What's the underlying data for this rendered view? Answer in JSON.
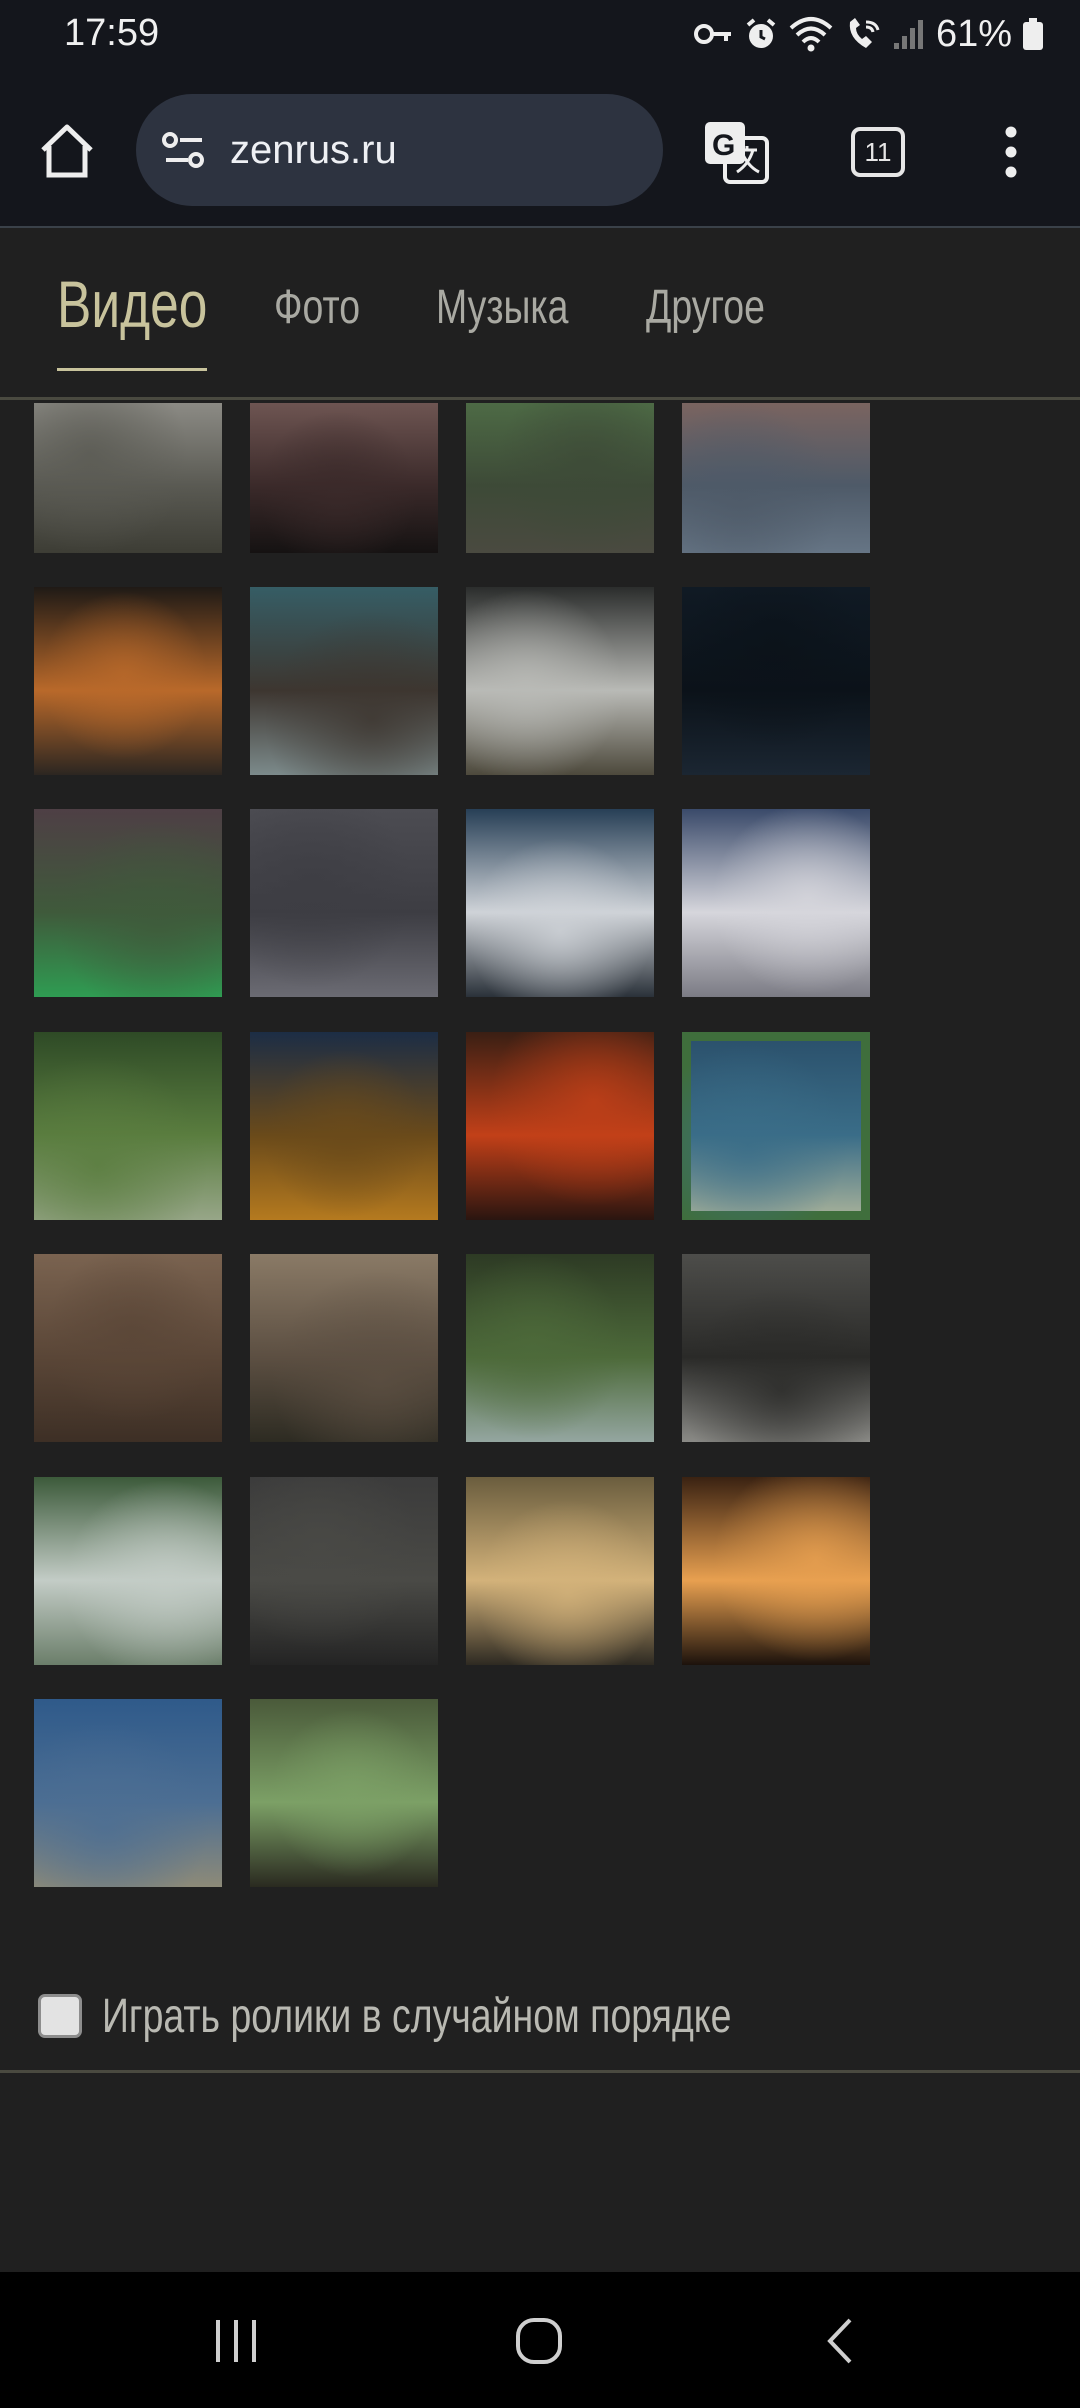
{
  "status_bar": {
    "time": "17:59",
    "battery": "61%",
    "icons": [
      "key-icon",
      "alarm-icon",
      "wifi-icon",
      "wifi-call-icon",
      "signal-icon",
      "battery-icon"
    ]
  },
  "browser": {
    "url": "zenrus.ru",
    "tab_count": "11"
  },
  "nav": {
    "tabs": [
      {
        "label": "Видео",
        "active": true
      },
      {
        "label": "Фото",
        "active": false
      },
      {
        "label": "Музыка",
        "active": false
      },
      {
        "label": "Другое",
        "active": false
      }
    ]
  },
  "gallery": {
    "thumbnails": [
      {
        "scene": "misty lake with reeds",
        "colors": [
          "#8c8b85",
          "#5a5a53",
          "#3d3d35"
        ]
      },
      {
        "scene": "oil pump at sunset",
        "colors": [
          "#6e5552",
          "#3b2a2a",
          "#151212"
        ]
      },
      {
        "scene": "green field rain",
        "colors": [
          "#4d6a45",
          "#3d4a37",
          "#4a4a40"
        ]
      },
      {
        "scene": "sea waves at dusk",
        "colors": [
          "#7a6460",
          "#4e5a68",
          "#667585"
        ]
      },
      {
        "scene": "sunset over lake with tree",
        "colors": [
          "#1f1a16",
          "#b9692a",
          "#2c2621"
        ]
      },
      {
        "scene": "city waterfall",
        "colors": [
          "#365d65",
          "#3d3630",
          "#7c8a8b"
        ]
      },
      {
        "scene": "tall waterfall",
        "colors": [
          "#2b2d2c",
          "#b9bab6",
          "#4d493c"
        ]
      },
      {
        "scene": "starry night sky",
        "colors": [
          "#101a24",
          "#0b1219",
          "#1b2632"
        ]
      },
      {
        "scene": "aurora green",
        "colors": [
          "#4e3f45",
          "#3f5a3b",
          "#2f9c52"
        ]
      },
      {
        "scene": "snowy tree in fog",
        "colors": [
          "#4c4c52",
          "#3d3d43",
          "#6b6b73"
        ]
      },
      {
        "scene": "snowy mountain peak clouds",
        "colors": [
          "#273f56",
          "#cfd3d8",
          "#2a3139"
        ]
      },
      {
        "scene": "snow mountain range",
        "colors": [
          "#3a4a6a",
          "#d6d6dc",
          "#7b7b84"
        ]
      },
      {
        "scene": "jungle leaves",
        "colors": [
          "#2e4a26",
          "#5a7d3f",
          "#97a688"
        ]
      },
      {
        "scene": "milky way sunset",
        "colors": [
          "#1c2d45",
          "#6a4a1a",
          "#b57a1f"
        ]
      },
      {
        "scene": "volcano lava",
        "colors": [
          "#3a1f14",
          "#c24018",
          "#2a1510"
        ]
      },
      {
        "scene": "jellyfish underwater",
        "colors": [
          "#2a4f6a",
          "#3a6d88",
          "#aab39a"
        ]
      },
      {
        "scene": "desert dunes",
        "colors": [
          "#7a6350",
          "#5a4637",
          "#3d2f25"
        ]
      },
      {
        "scene": "bolshoi theatre square",
        "colors": [
          "#8a7a66",
          "#5c4f42",
          "#2d2b22"
        ]
      },
      {
        "scene": "forest waterfall pool",
        "colors": [
          "#2d3a24",
          "#4d6a3a",
          "#94a6a0"
        ]
      },
      {
        "scene": "foggy river rapids",
        "colors": [
          "#4d4d4a",
          "#2a2a28",
          "#8a8a86"
        ]
      },
      {
        "scene": "wide waterfalls",
        "colors": [
          "#3c5a3a",
          "#c3ccc6",
          "#6b7e6a"
        ]
      },
      {
        "scene": "marina bay sands",
        "colors": [
          "#3b3b3b",
          "#4a4a46",
          "#242424"
        ]
      },
      {
        "scene": "sunset over sea",
        "colors": [
          "#6a5d3e",
          "#d3b27a",
          "#2e2a22"
        ]
      },
      {
        "scene": "fireplace fire",
        "colors": [
          "#3a2212",
          "#e8a050",
          "#1c120c"
        ]
      },
      {
        "scene": "beach palm",
        "colors": [
          "#2f5a8a",
          "#4c6e93",
          "#8d8a78"
        ]
      },
      {
        "scene": "green plant closeup",
        "colors": [
          "#4a5a3a",
          "#7ca066",
          "#2a2a20"
        ]
      }
    ]
  },
  "options": {
    "random_label": "Играть ролики в случайном порядке"
  }
}
